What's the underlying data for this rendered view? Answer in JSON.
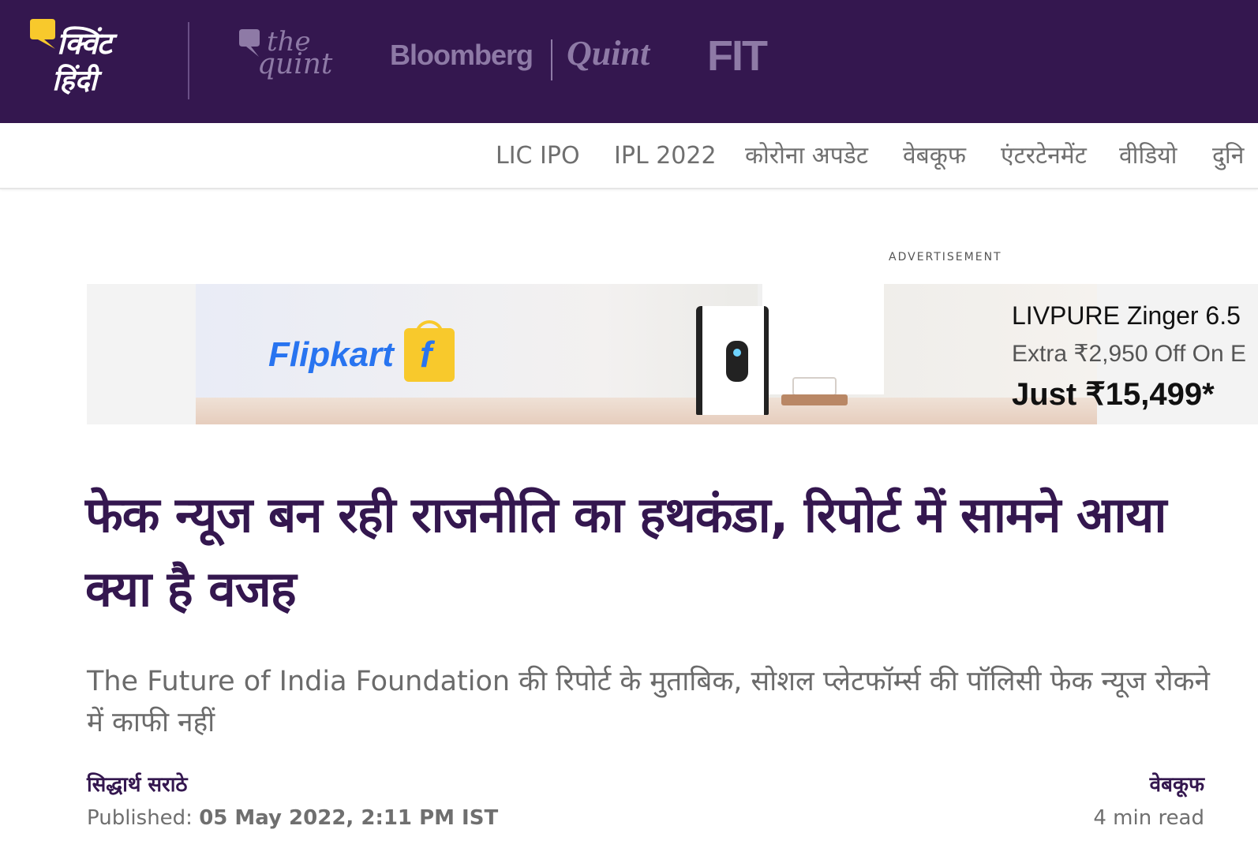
{
  "header": {
    "logo_line1": "क्विंट",
    "logo_line2": "हिंदी",
    "brands": {
      "thequint_the": "the",
      "thequint_quint": "quint",
      "bloomberg": "Bloomberg",
      "bq_quint": "Quint",
      "fit": "FIT"
    },
    "colors": {
      "bar": "#34174f",
      "logo_bubble": "#f8c92c",
      "brand_muted": "#8e7aa6"
    }
  },
  "nav": {
    "items": [
      {
        "label": "LIC IPO"
      },
      {
        "label": "IPL 2022"
      },
      {
        "label": "कोरोना अपडेट"
      },
      {
        "label": "वेबकूफ"
      },
      {
        "label": "एंटरटेनमेंट"
      },
      {
        "label": "वीडियो"
      },
      {
        "label": "दुनि"
      }
    ]
  },
  "ad": {
    "label": "ADVERTISEMENT",
    "brand": "Flipkart",
    "bag_letter": "f",
    "line1": "LIVPURE Zinger 6.5",
    "line2": "Extra ₹2,950 Off On E",
    "line3": "Just ₹15,499*",
    "colors": {
      "flipkart_blue": "#2874f0",
      "flipkart_yellow": "#f8c92c"
    }
  },
  "article": {
    "headline": "फेक न्यूज बन रही राजनीति का हथकंडा, रिपोर्ट में सामने आया क्या है वजह",
    "subhead": "The Future of India Foundation की रिपोर्ट के मुताबिक, सोशल प्लेटफॉर्म्स की पॉलिसी फेक न्यूज रोकने में काफी नहीं",
    "author": "सिद्धार्थ सराठे",
    "published_label": "Published: ",
    "published_date": "05 May 2022, 2:11 PM IST",
    "category": "वेबकूफ",
    "read_time": "4 min read",
    "colors": {
      "headline": "#34174f",
      "subhead": "#6b6b6b"
    }
  }
}
